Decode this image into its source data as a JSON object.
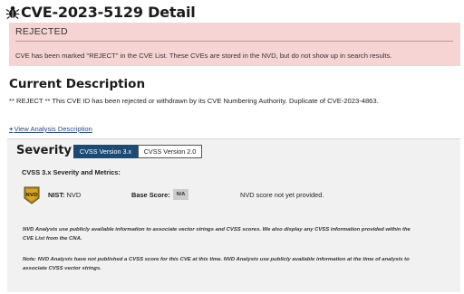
{
  "header": {
    "title": "CVE-2023-5129 Detail",
    "icon": "bug-icon"
  },
  "rejected": {
    "label": "REJECTED",
    "message": "CVE has been marked \"REJECT\" in the CVE List. These CVEs are stored in the NVD, but do not show up in search results.",
    "background_color": "#f6d4d4"
  },
  "description": {
    "heading": "Current Description",
    "text": "** REJECT ** This CVE ID has been rejected or withdrawn by its CVE Numbering Authority. Duplicate of CVE-2023-4863.",
    "analysis_link_icon": "+",
    "analysis_link": "View Analysis Description"
  },
  "severity": {
    "heading": "Severity",
    "tabs": [
      {
        "label": "CVSS Version 3.x",
        "active": true
      },
      {
        "label": "CVSS Version 2.0",
        "active": false
      }
    ],
    "active_tab_color": "#1d4a75",
    "metrics_heading": "CVSS 3.x Severity and Metrics:",
    "nist_label": "NIST:",
    "nist_value": "NVD",
    "badge_text": "NVD",
    "base_score_label": "Base Score:",
    "base_score_value": "N/A",
    "score_note": "NVD score not yet provided.",
    "note1": "NVD Analysts use publicly available information to associate vector strings and CVSS scores. We also display any CVSS information provided within the CVE List from the CNA.",
    "note2": "Note: NVD Analysts have not published a CVSS score for this CVE at this time. NVD Analysts use publicly available information at the time of analysis to associate CVSS vector strings."
  }
}
